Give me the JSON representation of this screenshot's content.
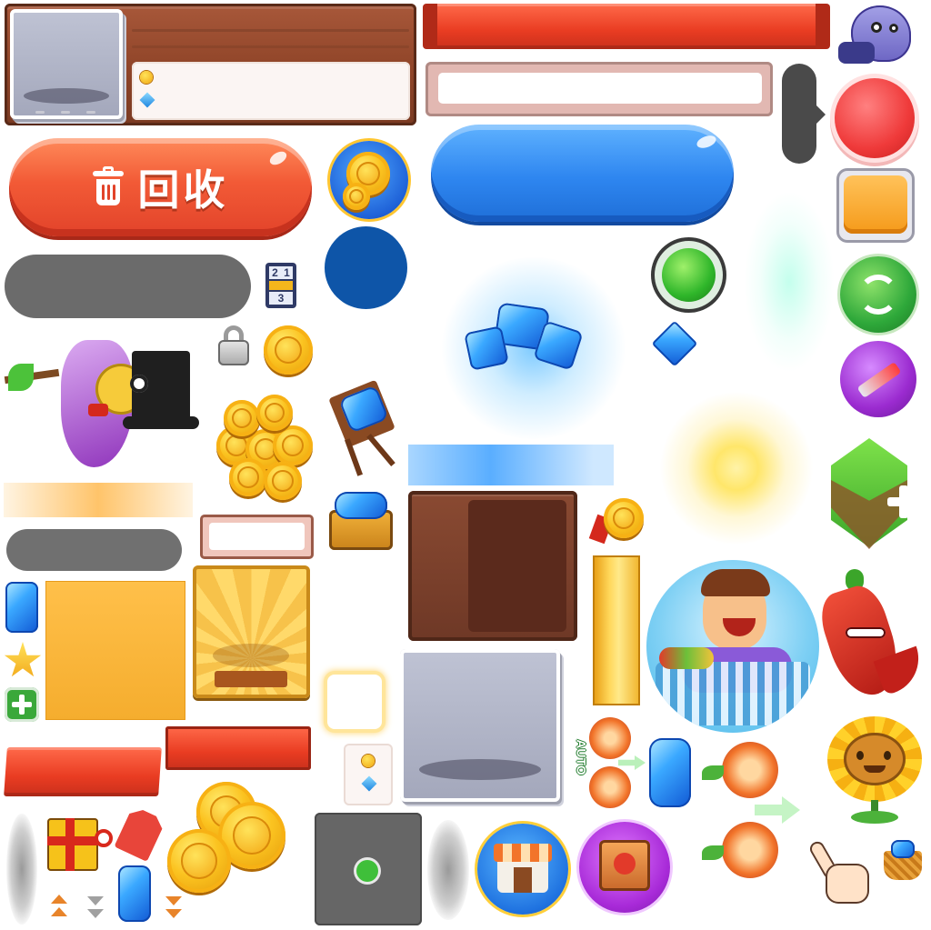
{
  "buttons": {
    "recycle_label": "回收",
    "auto_label": "AUTO"
  },
  "lock_counter": {
    "top_digit_left": "2",
    "top_digit_right": "1",
    "bottom_digit": "3"
  },
  "icons": {
    "coin": "coin-icon",
    "gem": "gem-icon",
    "trash": "trash-icon",
    "lock": "lock-icon",
    "refresh": "refresh-icon",
    "plus": "plus-icon",
    "star": "star-icon",
    "hand": "pointing-hand-icon"
  },
  "colors": {
    "recycle_red": "#f25a36",
    "button_blue": "#2e86f0",
    "ribbon_red": "#e93c22",
    "gold": "#fbc320",
    "wood_brown": "#8f4428",
    "gem_blue": "#1e86e0",
    "green": "#2ea83a",
    "purple": "#9b2bd0"
  }
}
